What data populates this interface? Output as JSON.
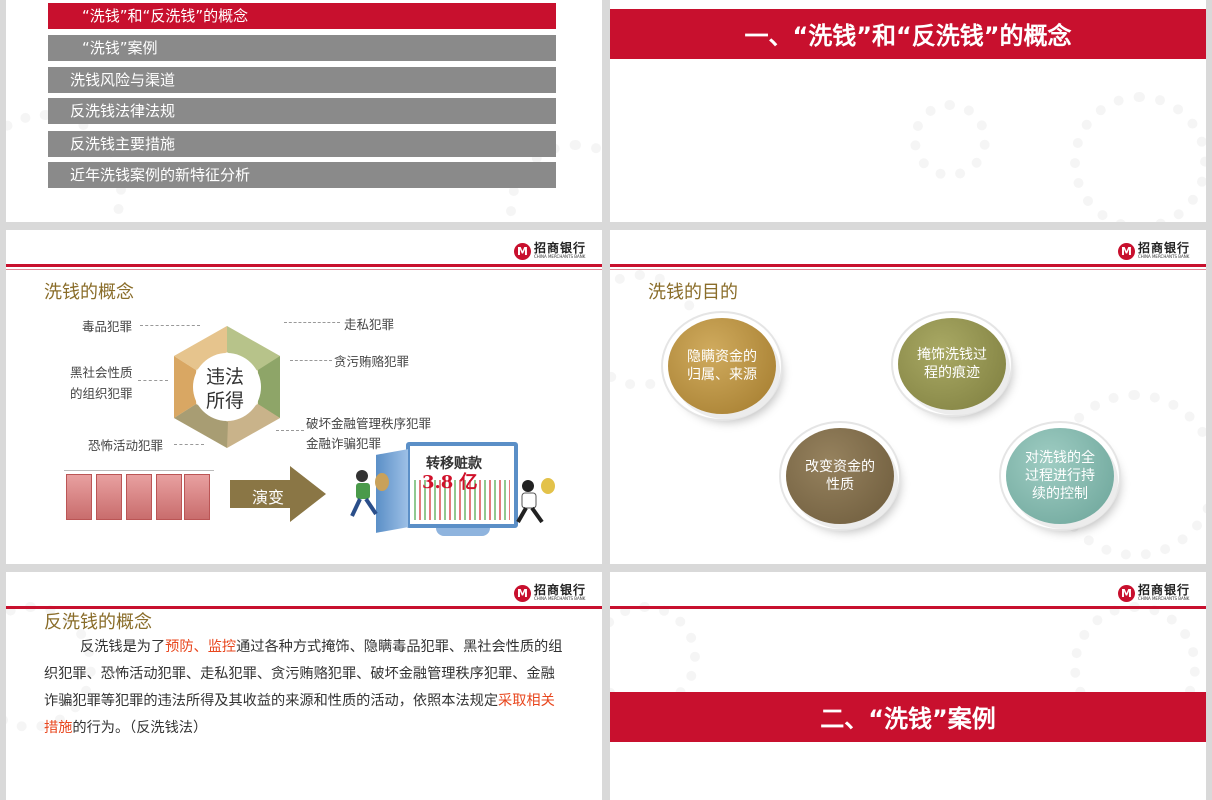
{
  "slide1": {
    "menu": [
      {
        "label": "“洗钱”和“反洗钱”的概念",
        "active": true
      },
      {
        "label": "“洗钱”案例",
        "active": false
      },
      {
        "label": "洗钱风险与渠道",
        "active": false
      },
      {
        "label": "反洗钱法律法规",
        "active": false
      },
      {
        "label": "反洗钱主要措施",
        "active": false
      },
      {
        "label": "近年洗钱案例的新特征分析",
        "active": false
      }
    ]
  },
  "slide2": {
    "banner": "一、“洗钱”和“反洗钱”的概念"
  },
  "logo": {
    "mark": "M",
    "cn": "招商银行",
    "en": "CHINA MERCHANTS BANK"
  },
  "slide3": {
    "title": "洗钱的概念",
    "center": [
      "违法",
      "所得"
    ],
    "left_crimes": [
      "毒品犯罪",
      "黑社会性质",
      "的组织犯罪",
      "恐怖活动犯罪"
    ],
    "right_crimes": [
      "走私犯罪",
      "贪污贿赂犯罪",
      "破坏金融管理秩序犯罪",
      "金融诈骗犯罪"
    ],
    "arrow_label": "演变",
    "screen_title": "转移赃款",
    "screen_amount": "3.8 亿"
  },
  "slide4": {
    "title": "洗钱的目的",
    "bubbles": [
      {
        "text": "隐瞒资金的归属、来源",
        "color": "#b08a3a"
      },
      {
        "text": "掩饰洗钱过程的痕迹",
        "color": "#8c8c4a"
      },
      {
        "text": "改变资金的性质",
        "color": "#7d6a4a"
      },
      {
        "text": "对洗钱的全过程进行持续的控制",
        "color": "#7fb5aa"
      }
    ]
  },
  "slide5": {
    "title": "反洗钱的概念",
    "p_a": "反洗钱是为了",
    "p_hl1": "预防、监控",
    "p_b": "通过各种方式掩饰、隐瞒毒品犯罪、黑社会性质的组织犯罪、恐怖活动犯罪、走私犯罪、贪污贿赂犯罪、破坏金融管理秩序犯罪、金融诈骗犯罪等犯罪的违法所得及其收益的来源和性质的活动，依照本法规定",
    "p_hl2": "采取相关措施",
    "p_c": "的行为。（反洗钱法）"
  },
  "slide6": {
    "banner": "二、“洗钱”案例"
  }
}
